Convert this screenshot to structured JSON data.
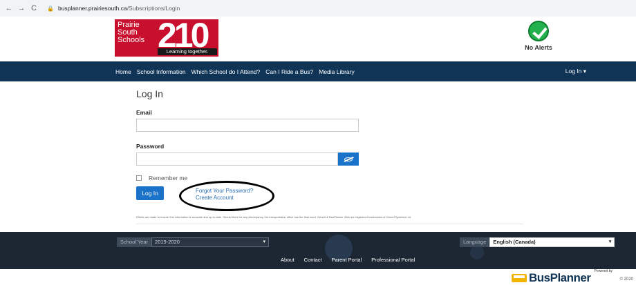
{
  "browser": {
    "back": "←",
    "forward": "→",
    "reload": "C",
    "lock": "🔒",
    "url_host": "busplanner.prairiesouth.ca",
    "url_path": "/Subscriptions/Login"
  },
  "header": {
    "logo_line1": "Prairie",
    "logo_line2": "South",
    "logo_line3": "Schools",
    "logo_number": "210",
    "logo_tagline": "Learning together.",
    "alerts_label": "No Alerts"
  },
  "nav": {
    "items": [
      "Home",
      "School Information",
      "Which School do I Attend?",
      "Can I Ride a Bus?",
      "Media Library"
    ],
    "login": "Log In ▾"
  },
  "form": {
    "title": "Log In",
    "email_label": "Email",
    "email_value": "",
    "password_label": "Password",
    "password_value": "",
    "remember_label": "Remember me",
    "login_button": "Log In",
    "forgot_password": "Forgot Your Password?",
    "create_account": "Create Account",
    "disclaimer": "Efforts are made to ensure this information is accurate and up-to-date. Should there be any discrepancy, the transportation office has the final word. Georef & BusPlanner Web are registered trademarks of Georef Systems Ltd."
  },
  "footer": {
    "school_year_label": "School Year",
    "school_year_value": "2019-2020",
    "language_label": "Language",
    "language_value": "English (Canada)",
    "links": [
      "About",
      "Contact",
      "Parent Portal",
      "Professional Portal"
    ],
    "powered_by": "Powered by",
    "brand": "BusPlanner",
    "copyright": "© 2020"
  },
  "icons": {
    "alert_status": "check-circle-icon",
    "password_toggle": "eye-slash-icon",
    "dropdown": "chevron-down-icon"
  },
  "colors": {
    "nav_bg": "#0f3456",
    "primary_button": "#1a73c9",
    "logo_red": "#c8102e",
    "alert_green": "#22b14c",
    "footer_bg": "#1d2733"
  }
}
